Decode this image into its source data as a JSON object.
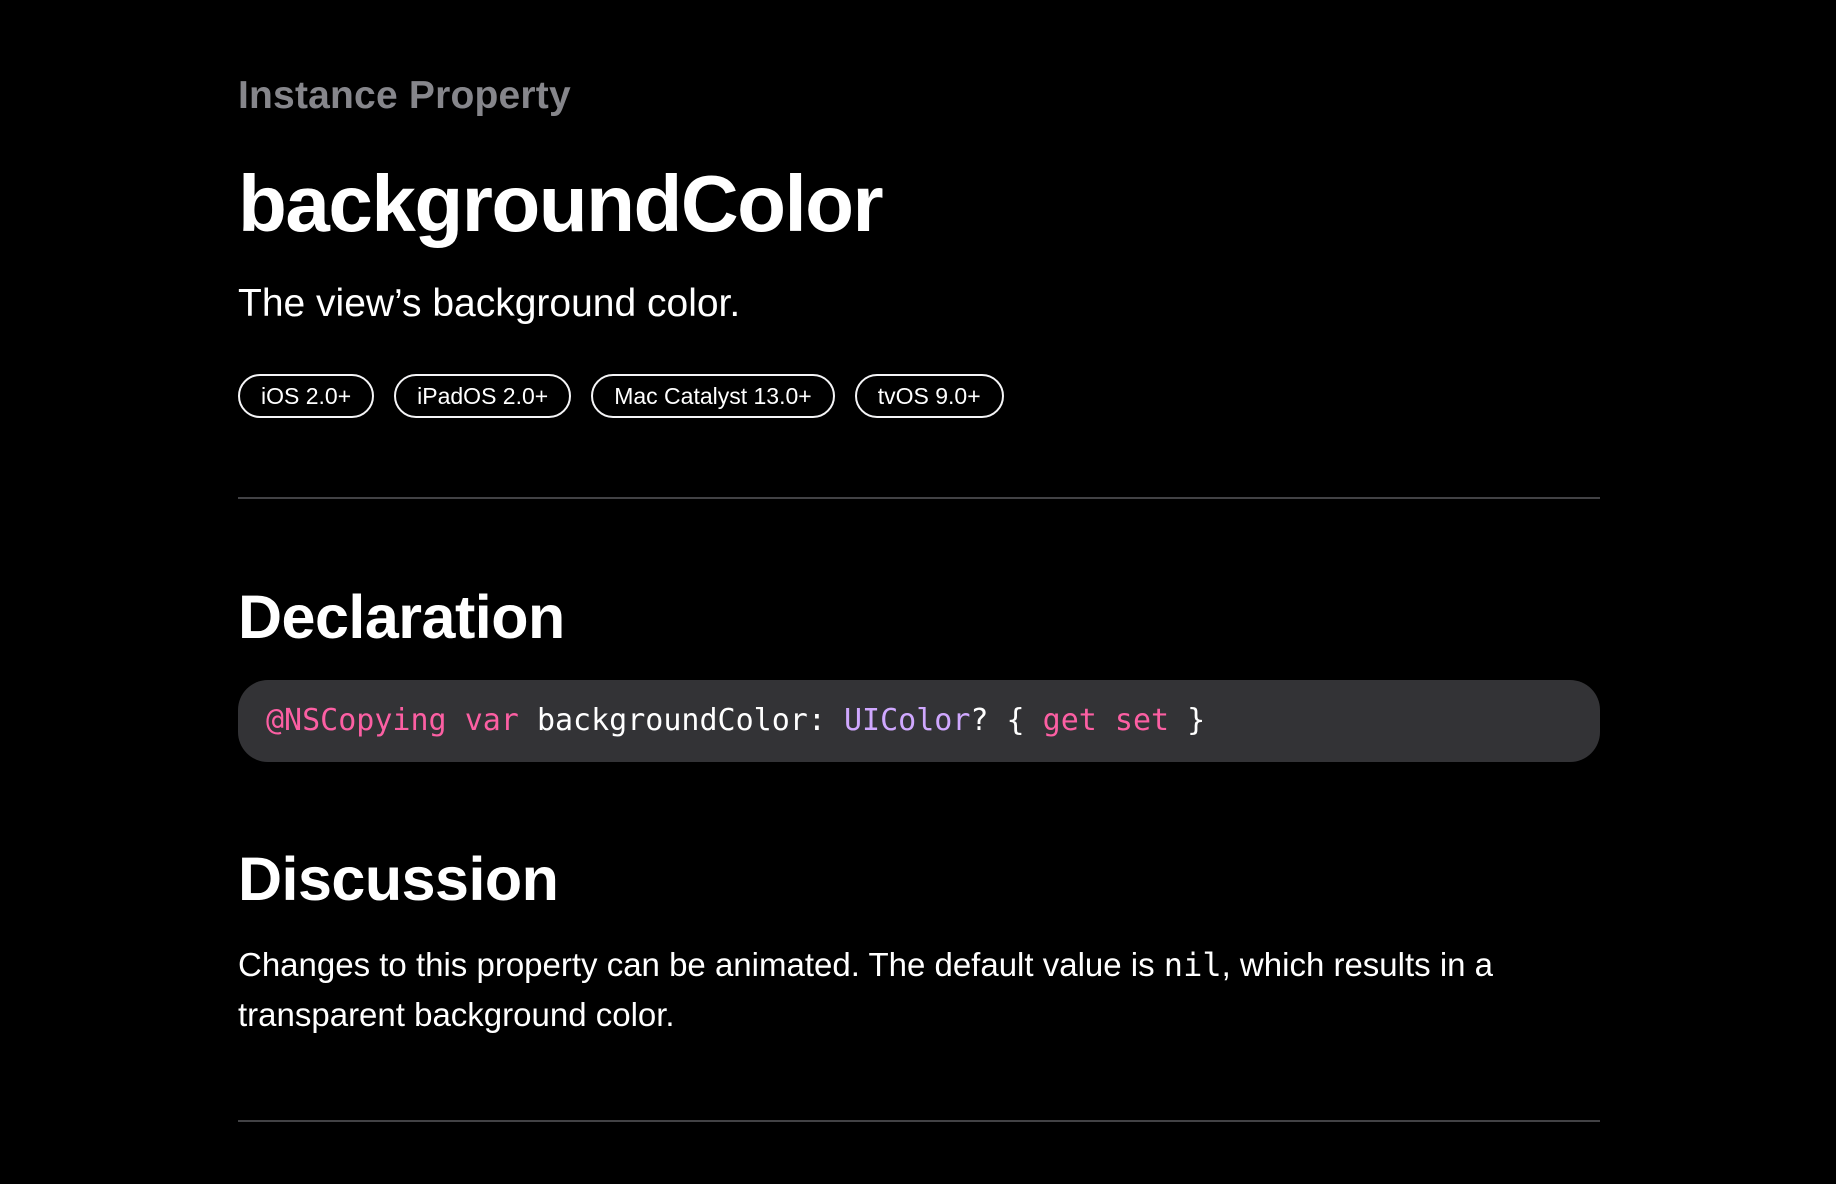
{
  "header": {
    "eyebrow": "Instance Property",
    "title": "backgroundColor",
    "abstract": "The view’s background color."
  },
  "availability": [
    {
      "label": "iOS 2.0+"
    },
    {
      "label": "iPadOS 2.0+"
    },
    {
      "label": "Mac Catalyst 13.0+"
    },
    {
      "label": "tvOS 9.0+"
    }
  ],
  "declaration": {
    "heading": "Declaration",
    "tokens": {
      "attribute": "@NSCopying",
      "var_keyword": "var",
      "name": "backgroundColor:",
      "type": "UIColor",
      "optional_open": "? {",
      "get_keyword": "get",
      "set_keyword": "set",
      "close": "}"
    }
  },
  "discussion": {
    "heading": "Discussion",
    "text_before": "Changes to this property can be animated. The default value is ",
    "code": "nil",
    "text_after": ", which results in a transparent background color."
  },
  "colors": {
    "background": "#000000",
    "eyebrow": "#86868b",
    "code_block_background": "#333336",
    "keyword": "#fc5fa3",
    "type": "#d0a8ff",
    "divider": "#424245"
  }
}
